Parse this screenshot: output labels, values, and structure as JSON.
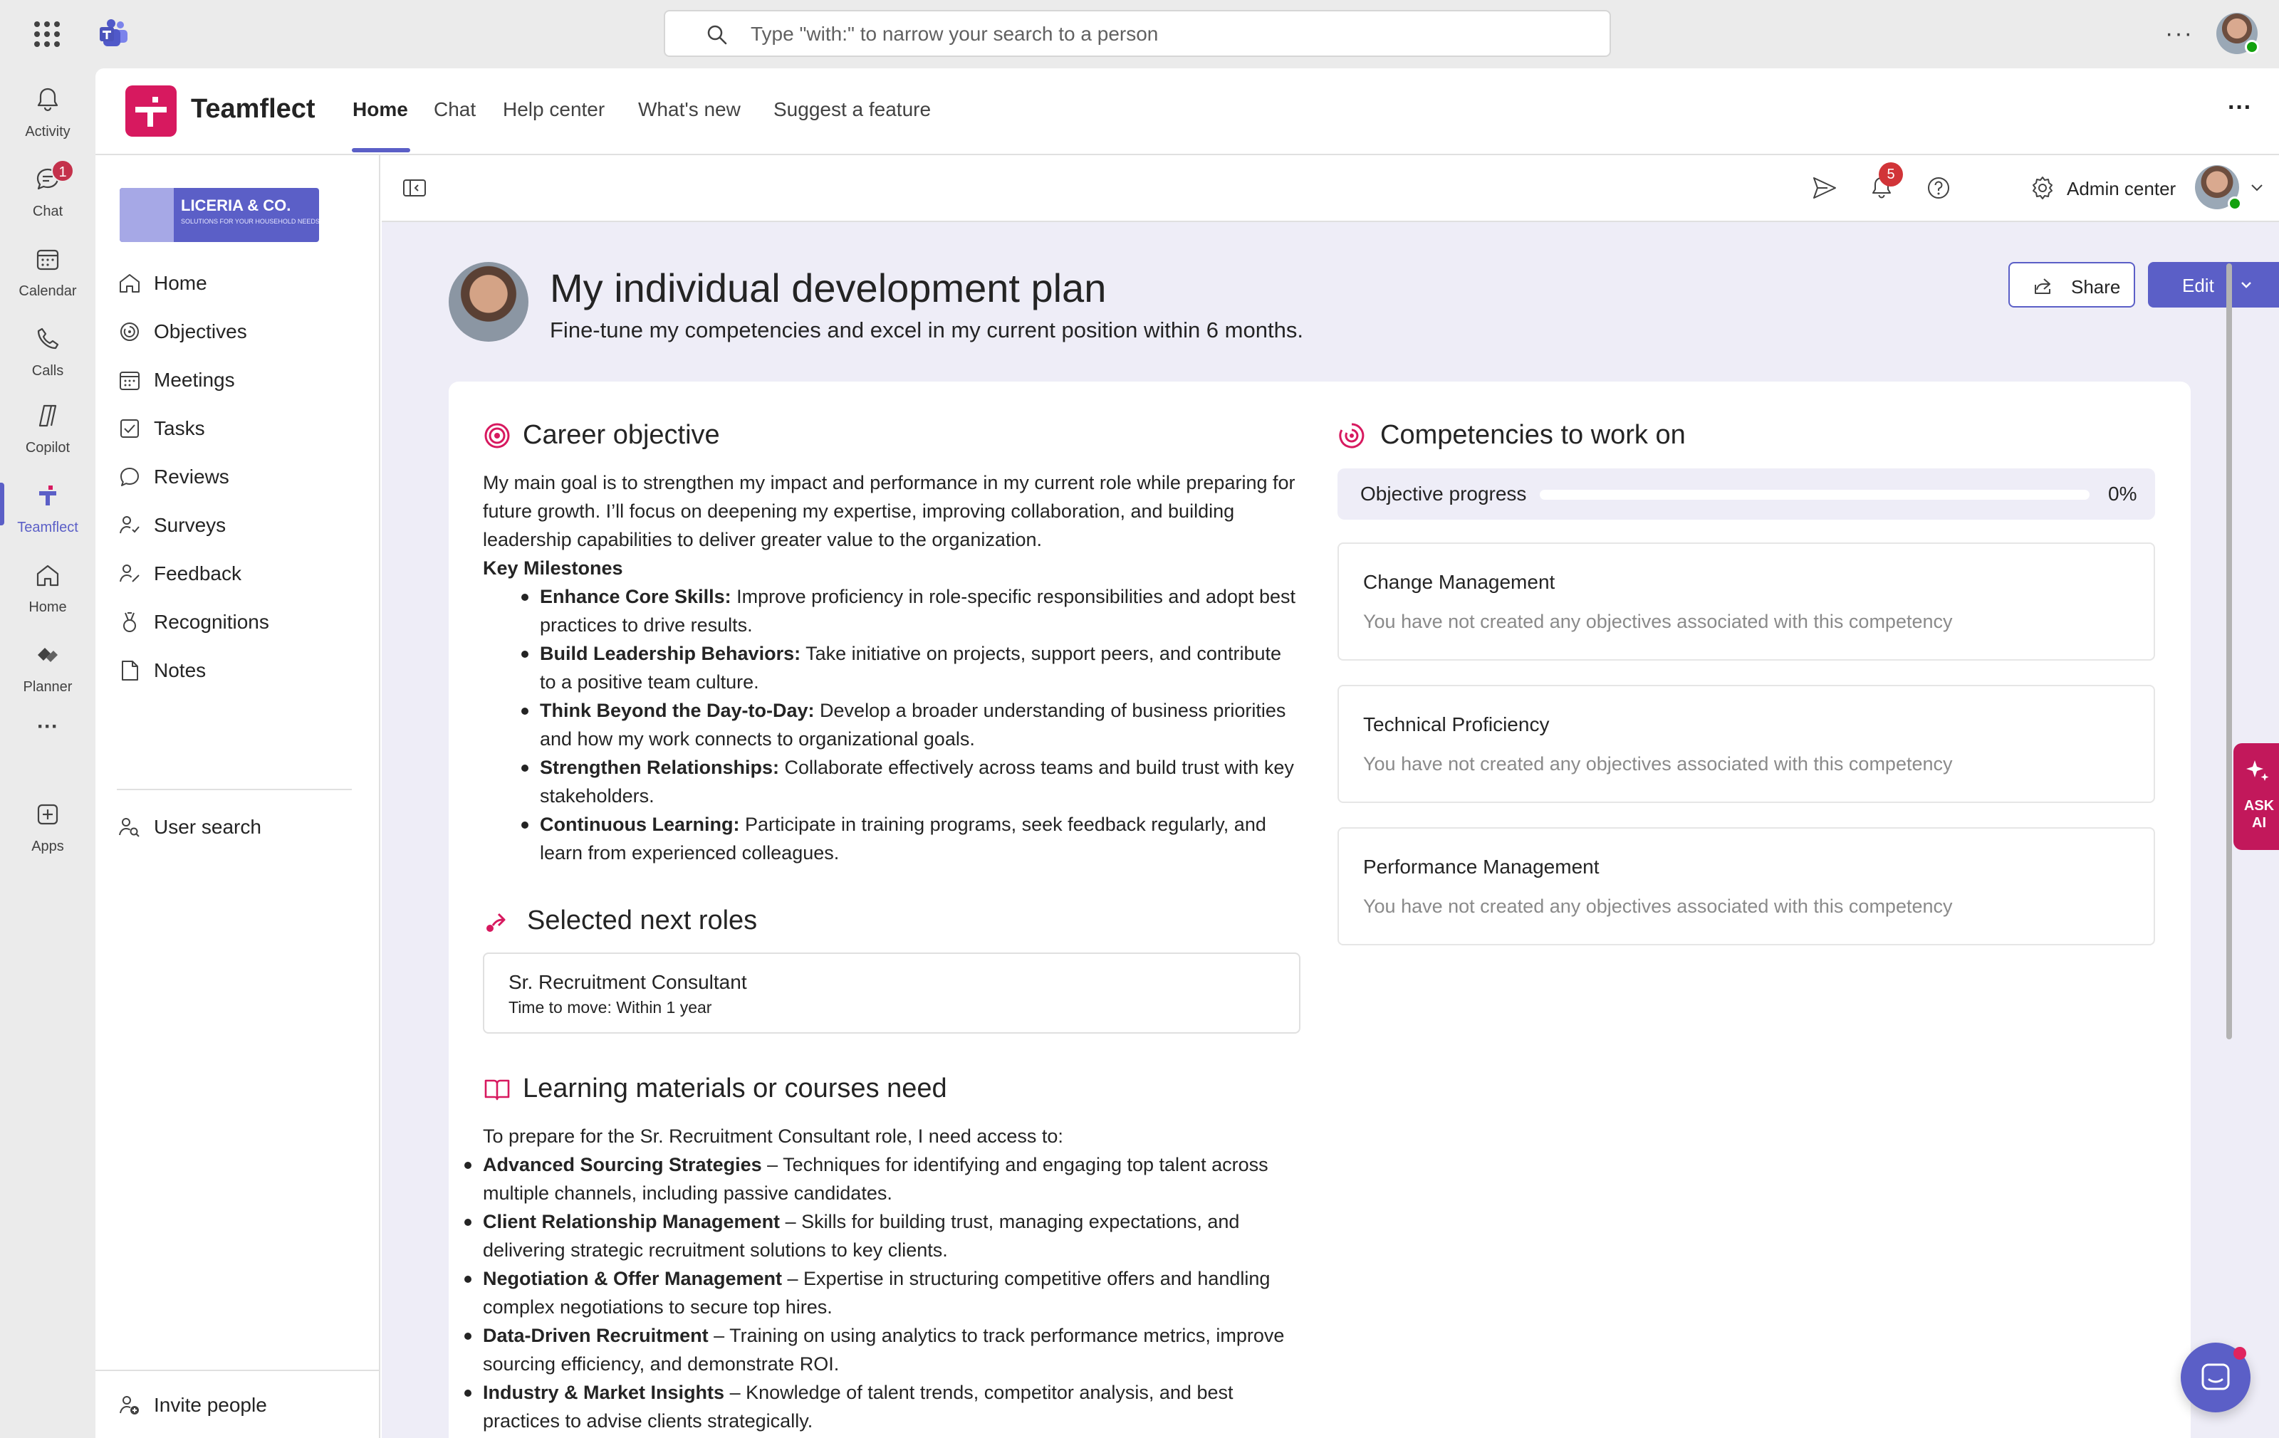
{
  "top": {
    "search_placeholder": "Type \"with:\" to narrow your search to a person",
    "more": "···"
  },
  "rail": {
    "items": [
      {
        "label": "Activity",
        "icon": "bell-icon"
      },
      {
        "label": "Chat",
        "icon": "chat-icon",
        "badge": "1"
      },
      {
        "label": "Calendar",
        "icon": "calendar-icon"
      },
      {
        "label": "Calls",
        "icon": "phone-icon"
      },
      {
        "label": "Copilot",
        "icon": "copilot-icon"
      },
      {
        "label": "Teamflect",
        "icon": "teamflect-icon",
        "active": true
      },
      {
        "label": "Home",
        "icon": "home-icon"
      },
      {
        "label": "Planner",
        "icon": "planner-icon"
      },
      {
        "label": "···",
        "icon": "more-icon"
      },
      {
        "label": "Apps",
        "icon": "add-app-icon"
      }
    ]
  },
  "app": {
    "name": "Teamflect",
    "tabs": [
      "Home",
      "Chat",
      "Help center",
      "What's new",
      "Suggest a feature"
    ],
    "active_tab": "Home",
    "more": "···"
  },
  "brand": {
    "name": "LICERIA & CO.",
    "tagline": "SOLUTIONS FOR YOUR HOUSEHOLD NEEDS"
  },
  "sidebar": {
    "items": [
      "Home",
      "Objectives",
      "Meetings",
      "Tasks",
      "Reviews",
      "Surveys",
      "Feedback",
      "Recognitions",
      "Notes"
    ],
    "user_search": "User search",
    "invite": "Invite people"
  },
  "toolbar": {
    "notifications_badge": "5",
    "admin_center": "Admin center"
  },
  "plan": {
    "title": "My individual development plan",
    "subtitle": "Fine-tune my competencies and excel in my current position within 6 months.",
    "share_label": "Share",
    "edit_label": "Edit"
  },
  "career": {
    "title": "Career objective",
    "intro": "My main goal is to strengthen my impact and performance in my current role while preparing for future growth. I’ll focus on deepening my expertise, improving collaboration, and building leadership capabilities to deliver greater value to the organization.",
    "milestones_heading": "Key Milestones",
    "milestones": [
      {
        "bold": "Enhance Core Skills:",
        "text": " Improve proficiency in role-specific responsibilities and adopt best practices to drive results."
      },
      {
        "bold": "Build Leadership Behaviors:",
        "text": " Take initiative on projects, support peers, and contribute to a positive team culture."
      },
      {
        "bold": "Think Beyond the Day-to-Day:",
        "text": " Develop a broader understanding of business priorities and how my work connects to organizational goals."
      },
      {
        "bold": "Strengthen Relationships:",
        "text": " Collaborate effectively across teams and build trust with key stakeholders."
      },
      {
        "bold": "Continuous Learning:",
        "text": " Participate in training programs, seek feedback regularly, and learn from experienced colleagues."
      }
    ]
  },
  "roles": {
    "title": "Selected next roles",
    "items": [
      {
        "name": "Sr. Recruitment Consultant",
        "meta": "Time to move: Within 1 year"
      }
    ]
  },
  "learning": {
    "title": "Learning materials or courses need",
    "intro": "To prepare for the Sr. Recruitment Consultant role, I need access to:",
    "items": [
      {
        "bold": "Advanced Sourcing Strategies",
        "text": " – Techniques for identifying and engaging top talent across multiple channels, including passive candidates."
      },
      {
        "bold": "Client Relationship Management",
        "text": " – Skills for building trust, managing expectations, and delivering strategic recruitment solutions to key clients."
      },
      {
        "bold": "Negotiation & Offer Management",
        "text": " – Expertise in structuring competitive offers and handling complex negotiations to secure top hires."
      },
      {
        "bold": "Data-Driven Recruitment",
        "text": " – Training on using analytics to track performance metrics, improve sourcing efficiency, and demonstrate ROI."
      },
      {
        "bold": "Industry & Market Insights",
        "text": " – Knowledge of talent trends, competitor analysis, and best practices to advise clients strategically."
      }
    ]
  },
  "competencies": {
    "title": "Competencies to work on",
    "progress_label": "Objective progress",
    "progress_value": "0%",
    "progress_fraction": 0,
    "items": [
      {
        "name": "Change Management",
        "empty": "You have not created any objectives associated with this competency"
      },
      {
        "name": "Technical Proficiency",
        "empty": "You have not created any objectives associated with this competency"
      },
      {
        "name": "Performance Management",
        "empty": "You have not created any objectives associated with this competency"
      }
    ]
  },
  "ask_ai": {
    "label": "ASK AI"
  },
  "colors": {
    "accent": "#5b5fc7",
    "brand": "#d7195f"
  }
}
